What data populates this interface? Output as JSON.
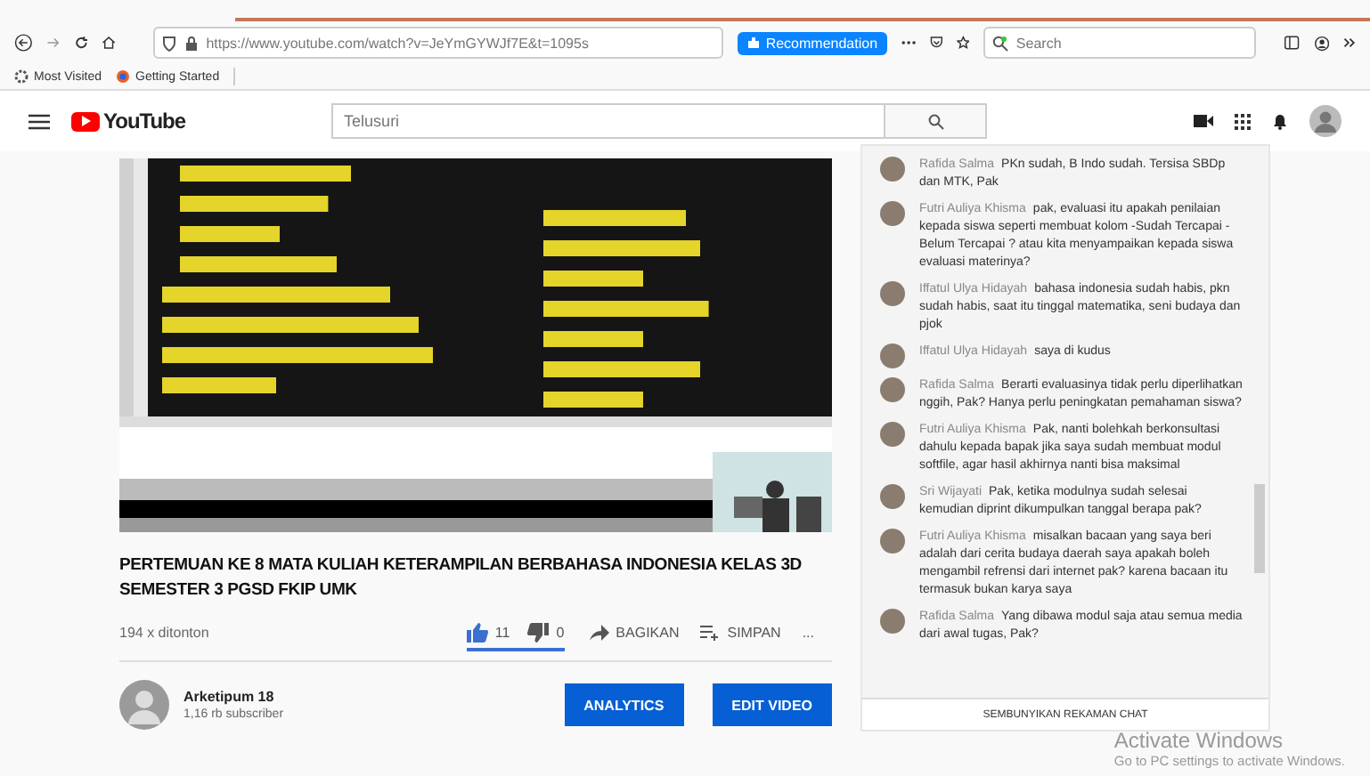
{
  "browser": {
    "url": "https://www.youtube.com/watch?v=JeYmGYWJf7E&t=1095s",
    "extension_button": "Recommendation",
    "search_placeholder": "Search",
    "bookmarks": [
      "Most Visited",
      "Getting Started"
    ]
  },
  "header": {
    "logo": "YouTube",
    "search_placeholder": "Telusuri"
  },
  "video": {
    "title": "PERTEMUAN KE 8 MATA KULIAH KETERAMPILAN BERBAHASA INDONESIA KELAS 3D SEMESTER 3 PGSD FKIP UMK",
    "views": "194 x ditonton",
    "likes": "11",
    "dislikes": "0",
    "sentiment": {
      "level": 1
    },
    "actions": [
      "BAGIKAN",
      "SIMPAN"
    ],
    "more": "..."
  },
  "channel": {
    "name": "Arketipum 18",
    "subscribers": "1,16 rb subscriber",
    "buttons": [
      "ANALYTICS",
      "EDIT VIDEO"
    ]
  },
  "chat": {
    "messages": [
      {
        "author": "Rafida Salma",
        "text": "PKn sudah, B Indo sudah. Tersisa SBDp dan MTK, Pak"
      },
      {
        "author": "Futri Auliya Khisma",
        "text": "pak, evaluasi itu apakah penilaian kepada siswa seperti membuat kolom -Sudah Tercapai -Belum Tercapai ? atau kita menyampaikan kepada siswa evaluasi materinya?"
      },
      {
        "author": "Iffatul Ulya Hidayah",
        "text": "bahasa indonesia sudah habis, pkn sudah habis, saat itu tinggal matematika, seni budaya dan pjok"
      },
      {
        "author": "Iffatul Ulya Hidayah",
        "text": "saya di kudus"
      },
      {
        "author": "Rafida Salma",
        "text": "Berarti evaluasinya tidak perlu diperlihatkan nggih, Pak? Hanya perlu peningkatan pemahaman siswa?"
      },
      {
        "author": "Futri Auliya Khisma",
        "text": "Pak, nanti bolehkah berkonsultasi dahulu kepada bapak jika saya sudah membuat modul softfile, agar hasil akhirnya nanti bisa maksimal"
      },
      {
        "author": "Sri Wijayati",
        "text": "Pak, ketika modulnya sudah selesai kemudian diprint dikumpulkan tanggal berapa pak?"
      },
      {
        "author": "Futri Auliya Khisma",
        "text": "misalkan bacaan yang saya beri adalah dari cerita budaya daerah saya apakah boleh mengambil refrensi dari internet pak? karena bacaan itu termasuk bukan karya saya"
      },
      {
        "author": "Rafida Salma",
        "text": "Yang dibawa modul saja atau semua media dari awal tugas, Pak?"
      }
    ],
    "hide_button": "SEMBUNYIKAN REKAMAN CHAT"
  },
  "os_notice": {
    "title": "Activate Windows",
    "subtitle": "Go to PC settings to activate Windows."
  }
}
